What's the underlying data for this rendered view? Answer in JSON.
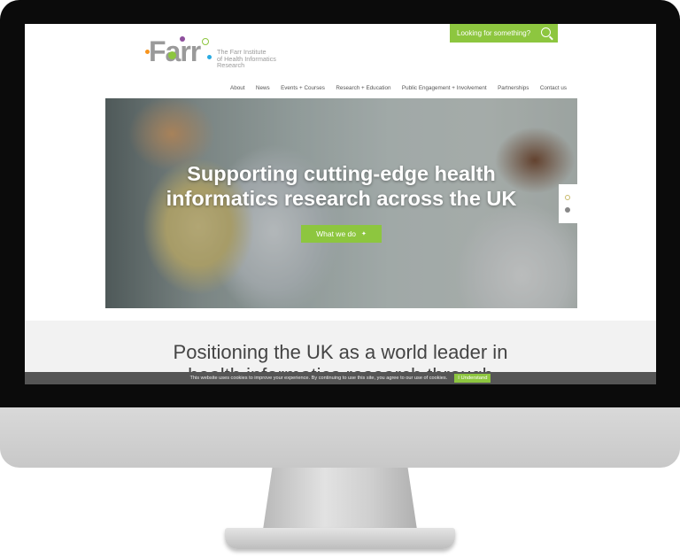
{
  "search": {
    "label": "Looking for something?"
  },
  "logo": {
    "word": "Farr",
    "subtitle": [
      "The Farr Institute",
      "of Health Informatics",
      "Research"
    ]
  },
  "nav": [
    "About",
    "News",
    "Events + Courses",
    "Research + Education",
    "Public Engagement + Involvement",
    "Partnerships",
    "Contact us"
  ],
  "hero": {
    "title_line1": "Supporting cutting-edge health",
    "title_line2": "informatics research across the UK",
    "button": "What we do"
  },
  "band": {
    "line1": "Positioning the UK as a world leader in",
    "line2": "health informatics research through"
  },
  "cookie": {
    "text": "This website uses cookies to improve your experience. By continuing to use this site, you agree to our use of cookies.",
    "button": "I Understand"
  },
  "colors": {
    "accent": "#8dc63f",
    "bezel": "#0b0b0b",
    "band": "#f2f2f2"
  },
  "icons": [
    "search-icon",
    "arrow-right-icon"
  ]
}
